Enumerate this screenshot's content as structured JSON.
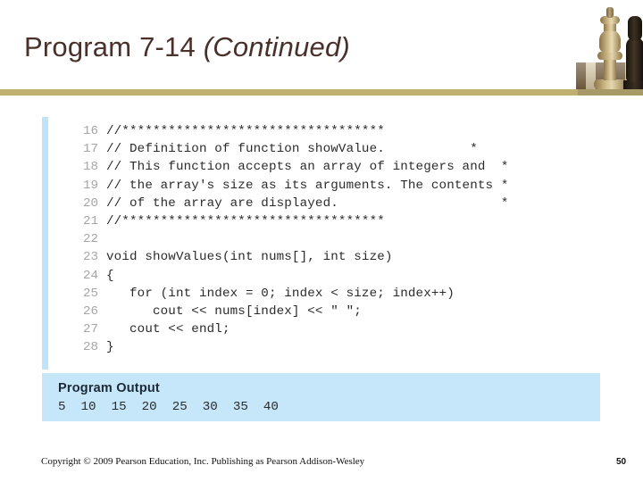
{
  "slide": {
    "title_main": "Program 7-14 ",
    "title_italic": "(Continued)"
  },
  "decor": {
    "gold_rule_color": "#bfb072",
    "title_color": "#4a302b",
    "code_stripe_color": "#bfe3f7",
    "output_panel_color": "#c6e7fa",
    "chess_light_piece": "chess-king-light",
    "chess_dark_piece": "chess-piece-dark",
    "chessboard": "chessboard-surface"
  },
  "code": {
    "lines": [
      {
        "num": "16",
        "text": "//**********************************"
      },
      {
        "num": "17",
        "text": "// Definition of function showValue.           *"
      },
      {
        "num": "18",
        "text": "// This function accepts an array of integers and  *"
      },
      {
        "num": "19",
        "text": "// the array's size as its arguments. The contents *"
      },
      {
        "num": "20",
        "text": "// of the array are displayed.                     *"
      },
      {
        "num": "21",
        "text": "//**********************************"
      },
      {
        "num": "22",
        "text": ""
      },
      {
        "num": "23",
        "text": "void showValues(int nums[], int size)"
      },
      {
        "num": "24",
        "text": "{"
      },
      {
        "num": "25",
        "text": "   for (int index = 0; index < size; index++)"
      },
      {
        "num": "26",
        "text": "      cout << nums[index] << \" \";"
      },
      {
        "num": "27",
        "text": "   cout << endl;"
      },
      {
        "num": "28",
        "text": "}"
      }
    ]
  },
  "output": {
    "heading": "Program Output",
    "values": "5  10  15  20  25  30  35  40"
  },
  "footer": {
    "copyright": "Copyright © 2009 Pearson Education, Inc. Publishing as Pearson Addison-Wesley",
    "page_number": "50"
  }
}
